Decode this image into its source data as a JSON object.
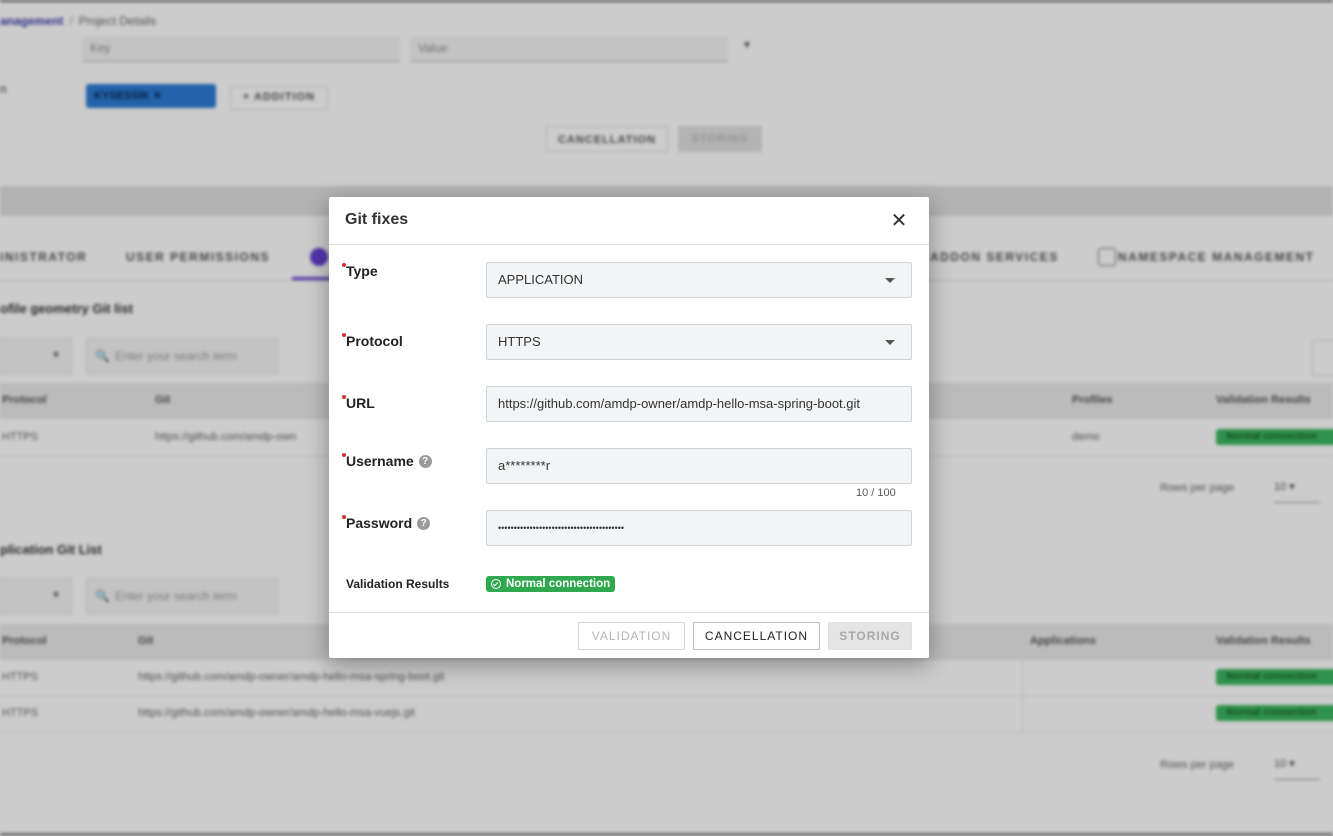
{
  "background": {
    "breadcrumb": {
      "parent": "anagement",
      "separator": "/",
      "current": "Project Details"
    },
    "filter_fields": {
      "key_placeholder": "Key",
      "value_placeholder": "Value"
    },
    "side_label": "n",
    "chip": {
      "label": "KYSESSIK",
      "close": "✕"
    },
    "add_button": "+ ADDITION",
    "form_buttons": {
      "cancel": "CANCELLATION",
      "store": "STORING"
    },
    "tabs": [
      "INISTRATOR",
      "USER PERMISSIONS",
      "ADDON SERVICES",
      "NAMESPACE MANAGEMENT"
    ],
    "section1": {
      "title": "ofile geometry Git list",
      "search_placeholder": "Enter your search term",
      "columns": [
        "Protocol",
        "Git",
        "Profiles",
        "Validation Results"
      ],
      "rows": [
        {
          "protocol": "HTTPS",
          "git": "https://github.com/amdp-own",
          "profiles": "demo",
          "status": "Normal connection"
        }
      ],
      "rows_per_page_label": "Rows per page",
      "rows_per_page": "10"
    },
    "section2": {
      "title": "plication Git List",
      "search_placeholder": "Enter your search term",
      "columns": [
        "Protocol",
        "Git",
        "Applications",
        "Validation Results"
      ],
      "rows": [
        {
          "protocol": "HTTPS",
          "git": "https://github.com/amdp-owner/amdp-hello-msa-spring-boot.git",
          "status": "Normal connection"
        },
        {
          "protocol": "HTTPS",
          "git": "https://github.com/amdp-owner/amdp-hello-msa-vuejs.git",
          "status": "Normal connection"
        }
      ],
      "rows_per_page_label": "Rows per page",
      "rows_per_page": "10"
    }
  },
  "modal": {
    "title": "Git fixes",
    "close_icon": "✕",
    "fields": {
      "type": {
        "label": "Type",
        "value": "APPLICATION"
      },
      "protocol": {
        "label": "Protocol",
        "value": "HTTPS"
      },
      "url": {
        "label": "URL",
        "value": "https://github.com/amdp-owner/amdp-hello-msa-spring-boot.git"
      },
      "username": {
        "label": "Username",
        "value": "a********r",
        "counter": "10 / 100",
        "help": "?"
      },
      "password": {
        "label": "Password",
        "value": "••••••••••••••••••••••••••••••••••••••••",
        "help": "?"
      }
    },
    "validation": {
      "label": "Validation Results",
      "status": "Normal connection",
      "status_color": "#2fa84f"
    },
    "buttons": {
      "validation": "VALIDATION",
      "cancel": "CANCELLATION",
      "store": "STORING"
    }
  }
}
